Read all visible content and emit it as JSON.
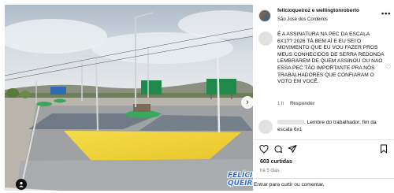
{
  "post": {
    "author": "felicioqueiroz e wellingtonroberto",
    "location": "São José dos Cordeiros",
    "more_glyph": "•••",
    "media_watermark": [
      "FELÍCIO",
      "QUEIROZ"
    ],
    "next_glyph": "›"
  },
  "comments": [
    {
      "text": "É A ASSINATURA NA PEC DA ESCALA 6X1?? 2026 TÁ BEM AÍ E EU SEI O MOVIMENTO QUE EU VOU FAZER PROS MEUS CONHECIDOS DE SERRA REDONDA LEMBRAREM DE QUEM ASSINOU OU NAO ESSA PEC TÃO IMPORTANTE PRA NÓS TRABALHADORES QUE CONFIARAM O VOTO EM VOCÊ.",
      "time": "1 h",
      "reply_label": "Responder"
    },
    {
      "text": ". Lembre do trabalhador, fim da escala 6x1",
      "time": "",
      "reply_label": ""
    }
  ],
  "stats": {
    "likes": "603 curtidas",
    "ago": "há 5 dias"
  },
  "footer": {
    "login_prompt": "Entrar para curtir ou comentar."
  },
  "icons": {
    "like": "heart-icon",
    "comment": "comment-icon",
    "share": "send-icon",
    "save": "bookmark-icon",
    "more": "more-icon",
    "next": "chevron-right-icon",
    "tag": "user-tag-icon"
  },
  "colors": {
    "watermark": "#2d6fd0",
    "sky": "#c9d3dc",
    "plaza_yellow": "#f2d33a",
    "plaza_green": "#3aa85a"
  }
}
